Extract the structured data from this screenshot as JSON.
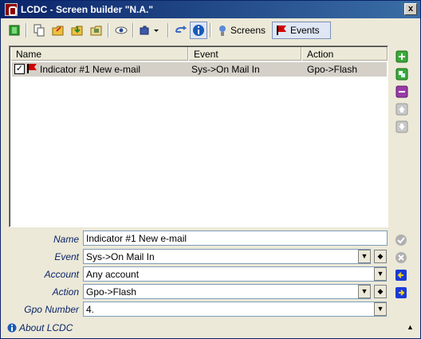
{
  "window": {
    "title": "LCDC - Screen builder \"N.A.\"",
    "close_glyph": "x"
  },
  "toolbar": {
    "screens_label": "Screens",
    "events_label": "Events"
  },
  "list": {
    "columns": [
      "Name",
      "Event",
      "Action"
    ],
    "rows": [
      {
        "checked": true,
        "name": "Indicator #1 New e-mail",
        "event": "Sys->On Mail In",
        "action": "Gpo->Flash"
      }
    ]
  },
  "form": {
    "name_label": "Name",
    "name_value": "Indicator #1 New e-mail",
    "event_label": "Event",
    "event_value": "Sys->On Mail In",
    "account_label": "Account",
    "account_value": "Any account",
    "action_label": "Action",
    "action_value": "Gpo->Flash",
    "gpo_label": "Gpo Number",
    "gpo_value": "4."
  },
  "status": {
    "about_label": "About LCDC"
  },
  "colors": {
    "title_start": "#0a246a",
    "title_end": "#3a6ea5",
    "form_label": "#0a246a"
  }
}
